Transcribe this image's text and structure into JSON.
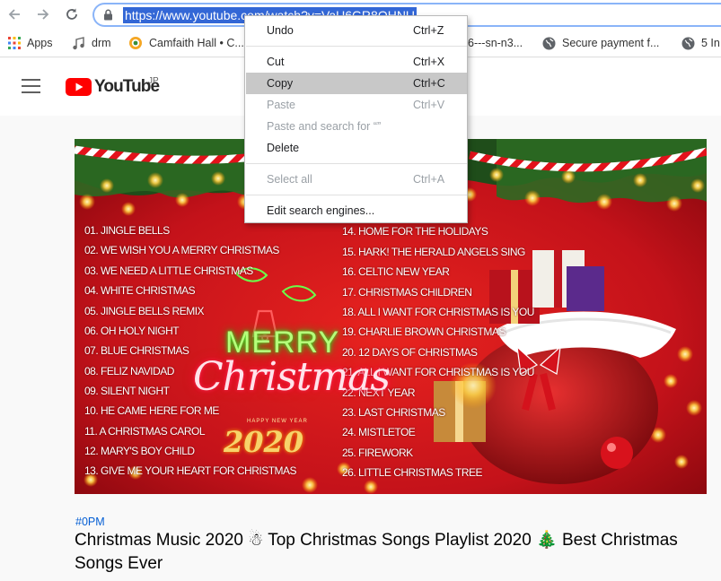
{
  "browser": {
    "url": "https://www.youtube.com/watch?v=VaU6GR8OHNU",
    "bookmarks": [
      {
        "label": "Apps",
        "icon": "apps-grid-icon"
      },
      {
        "label": "drm",
        "icon": "music-note-icon"
      },
      {
        "label": "Camfaith Hall • C...",
        "icon": "site-logo-icon"
      },
      {
        "label": "6---sn-n3...",
        "icon": "page-icon"
      },
      {
        "label": "Secure payment f...",
        "icon": "globe-icon"
      },
      {
        "label": "5 In",
        "icon": "globe-icon"
      }
    ]
  },
  "youtube": {
    "logo_text": "YouTube",
    "region": "JP"
  },
  "context_menu": {
    "items": [
      {
        "label": "Undo",
        "shortcut": "Ctrl+Z",
        "disabled": false
      },
      {
        "label": "Cut",
        "shortcut": "Ctrl+X",
        "disabled": false
      },
      {
        "label": "Copy",
        "shortcut": "Ctrl+C",
        "disabled": false,
        "highlighted": true
      },
      {
        "label": "Paste",
        "shortcut": "Ctrl+V",
        "disabled": true
      },
      {
        "label": "Paste and search for  “”",
        "shortcut": "",
        "disabled": true
      },
      {
        "label": "Delete",
        "shortcut": "",
        "disabled": false
      },
      {
        "label": "Select all",
        "shortcut": "Ctrl+A",
        "disabled": true
      },
      {
        "label": "Edit search engines...",
        "shortcut": "",
        "disabled": false
      }
    ]
  },
  "thumbnail": {
    "tracks_left": [
      "01. JINGLE BELLS",
      "02. WE WISH YOU A MERRY CHRISTMAS",
      "03. WE NEED A LITTLE CHRISTMAS",
      "04. WHITE CHRISTMAS",
      "05. JINGLE BELLS REMIX",
      "06. OH HOLY NIGHT",
      "07. BLUE CHRISTMAS",
      "08. FELIZ NAVIDAD",
      "09. SILENT NIGHT",
      "10. HE CAME HERE FOR ME",
      "11. A CHRISTMAS CAROL",
      "12. MARY'S BOY CHILD",
      "13. GIVE ME YOUR HEART FOR CHRISTMAS"
    ],
    "tracks_right": [
      "14. HOME FOR THE HOLIDAYS",
      "15. HARK! THE HERALD ANGELS SING",
      "16. CELTIC NEW YEAR",
      "17. CHRISTMAS CHILDREN",
      "18. ALL I WANT FOR CHRISTMAS IS YOU",
      "19. CHARLIE BROWN CHRISTMAS",
      "20. 12 DAYS OF CHRISTMAS",
      "21. ALL I WANT FOR CHRISTMAS IS YOU",
      "22. NEXT YEAR",
      "23. LAST CHRISTMAS",
      "24. MISTLETOE",
      "25. FIREWORK",
      "26. LITTLE CHRISTMAS TREE"
    ],
    "merry": "MERRY",
    "christmas": "Christmas",
    "happy_new_year": "HAPPY NEW YEAR",
    "year": "2020"
  },
  "video": {
    "hashtag": "#0PM",
    "title": "Christmas Music 2020 ☃ Top Christmas Songs Playlist 2020 🎄 Best Christmas Songs Ever"
  },
  "colors": {
    "url_selection": "#3367d6",
    "menu_highlight": "#c8c8c8",
    "youtube_red": "#ff0000",
    "hashtag_blue": "#065fd4"
  }
}
